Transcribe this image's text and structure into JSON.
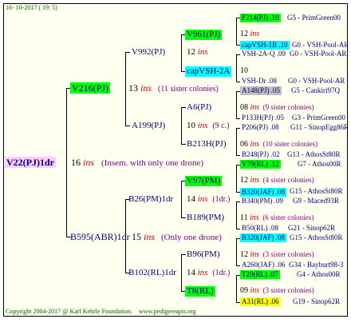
{
  "header": {
    "date": "16- 10-2017 ( 19: 5)"
  },
  "footer": {
    "copyright": "Copyright 2004-2017 @ Karl Kehrle Foundation.",
    "site": "www.pedigreeapis.org"
  },
  "colors": {
    "green": "#00ff00",
    "cyan": "#00ffff",
    "yellow": "#ffff00",
    "grey": "#c0c0c0",
    "root": "#ffccff",
    "ins": "#d00000",
    "sib": "#800080",
    "name": "#000080"
  },
  "root": {
    "name": "V22(PJ)1dr",
    "ins_count": "16",
    "ins_label": "ins",
    "note": "(Insem. with only one drone)"
  },
  "g1": [
    {
      "name": "V216(PJ)",
      "ins_count": "13",
      "ins_label": "ins",
      "note": "(11 sister colonies)"
    },
    {
      "name": "B595(ABR)1dr",
      "ins_count": "15",
      "ins_label": "ins",
      "note": "(Only one drone)"
    }
  ],
  "g2": [
    {
      "name": "V992(PJ)",
      "ins_count": "12",
      "ins_label": "ins"
    },
    {
      "name": "A199(PJ)",
      "ins_count": "10",
      "ins_label": "ins",
      "note": "(9 c.)"
    },
    {
      "name": "B26(PM)1dr",
      "ins_count": "14",
      "ins_label": "ins",
      "note": "(1dr.)"
    },
    {
      "name": "B102(RL)1dr",
      "ins_count": "14",
      "ins_label": "ins",
      "note": "(1dr.)"
    }
  ],
  "g3": [
    {
      "name": "V961(PJ)",
      "ins_count": "12",
      "ins_label": "ins"
    },
    {
      "name": "capVSH-2A",
      "ins_count": "10"
    },
    {
      "name": "A6(PJ)",
      "ins_count": "08",
      "ins_label": "ins",
      "note": "(9 sister colonies)"
    },
    {
      "name": "B213H(PJ)",
      "ins_count": "06",
      "ins_label": "ins",
      "note": "(10 sister colonies)"
    },
    {
      "name": "V97(PM)",
      "ins_count": "12",
      "ins_label": "ins",
      "note": "(4 sister colonies)"
    },
    {
      "name": "B189(PM)",
      "ins_count": "11",
      "ins_label": "ins",
      "note": "(6 sister colonies)"
    },
    {
      "name": "B96(PM)",
      "ins_count": "12",
      "ins_label": "ins",
      "note": "(3 sister colonies)"
    },
    {
      "name": "T8(RL)",
      "ins_count": "09",
      "ins_label": "ins",
      "note": "(3 sister colonies)"
    }
  ],
  "g4": [
    {
      "name": "F214(PJ) .10",
      "right": "G5 - PrimGreen00"
    },
    {
      "name": "capVSH-1B .10",
      "right": "G0 - VSH-Pool-AR"
    },
    {
      "name": "VSH-2A-Q .09",
      "right": "G0 - VSH-Pool-AR"
    },
    {
      "name": "VSH-Dr .08",
      "right": "G0 - VSH-Pool-AR"
    },
    {
      "name": "A148(PJ) .05",
      "right": "G5 - Cankiri97Q"
    },
    {
      "name": "P133H(PJ) .05",
      "right": "G3 - PrimGreen00"
    },
    {
      "name": "P206(PJ) .08",
      "right": "G11 - SinopEgg86R"
    },
    {
      "name": "B248(PJ) .02",
      "right": "G13 - AthosSt80R"
    },
    {
      "name": "V79(RL) .12",
      "right": "G7 - Athos00R"
    },
    {
      "name": "B320(JAF) .08",
      "right": "G15 - AthosSt80R"
    },
    {
      "name": "B340(PM) .09",
      "right": "G9 - Maced93R"
    },
    {
      "name": "B50(RL) .08",
      "right": "G21 - Sinop62R"
    },
    {
      "name": "B320(JAF) .08",
      "right": "G15 - AthosSt80R"
    },
    {
      "name": "A260(JAF) .06",
      "right": "G34 - Bayburt98-3"
    },
    {
      "name": "T29(RL) .07",
      "right": "G4 - Athos00R"
    },
    {
      "name": "A31(RL) .06",
      "right": "G19 - Sinop62R"
    }
  ]
}
